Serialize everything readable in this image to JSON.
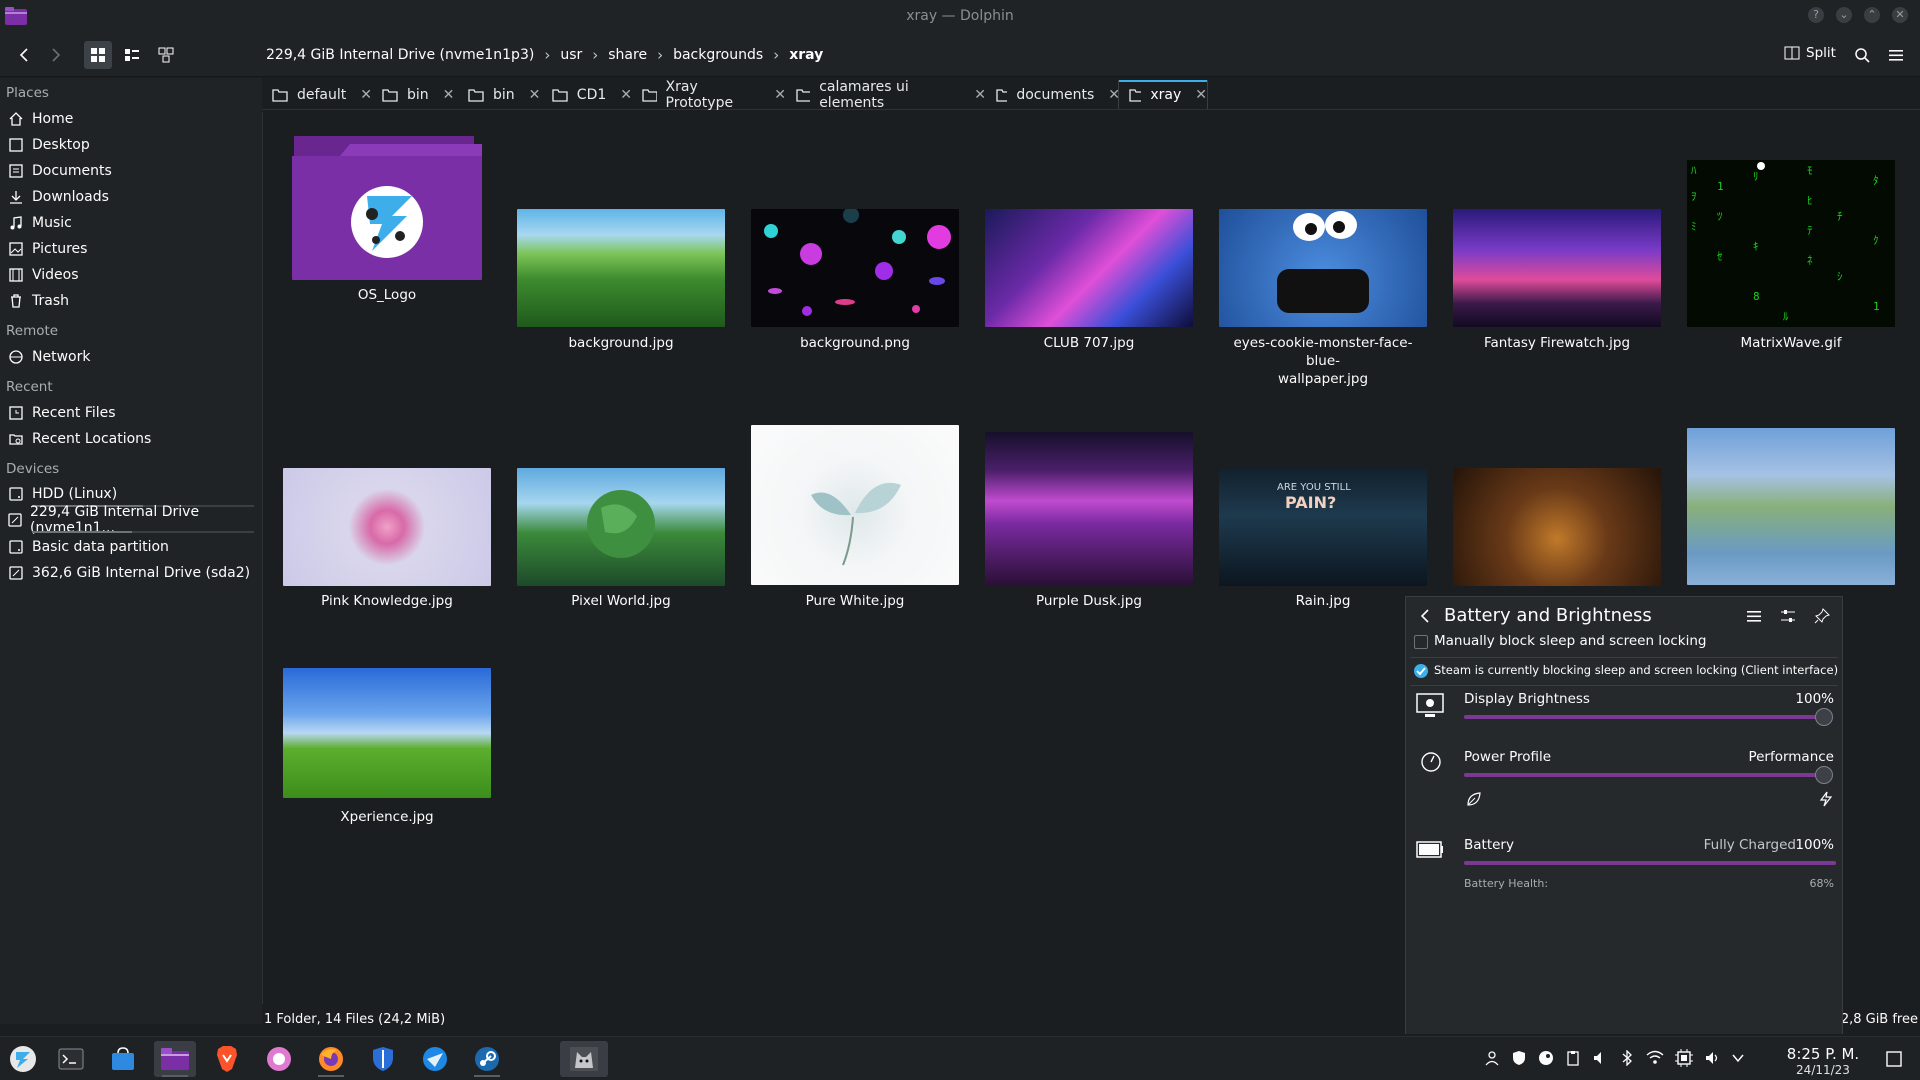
{
  "window": {
    "title": "xray — Dolphin"
  },
  "toolbar": {
    "breadcrumb": [
      "229,4 GiB Internal Drive (nvme1n1p3)",
      "usr",
      "share",
      "backgrounds",
      "xray"
    ],
    "split_label": "Split"
  },
  "sidebar": {
    "places_heading": "Places",
    "places": [
      "Home",
      "Desktop",
      "Documents",
      "Downloads",
      "Music",
      "Pictures",
      "Videos",
      "Trash"
    ],
    "remote_heading": "Remote",
    "remote": [
      "Network"
    ],
    "recent_heading": "Recent",
    "recent": [
      "Recent Files",
      "Recent Locations"
    ],
    "devices_heading": "Devices",
    "devices": [
      {
        "label": "HDD (Linux)",
        "used_fraction": 0.5
      },
      {
        "label": "229,4 GiB Internal Drive (nvme1n1...",
        "used_fraction": 0.45
      },
      {
        "label": "Basic data partition"
      },
      {
        "label": "362,6 GiB Internal Drive (sda2)"
      }
    ]
  },
  "tabs": [
    "default",
    "bin",
    "bin",
    "CD1",
    "Xray Prototype",
    "calamares ui elements",
    "documents",
    "xray"
  ],
  "active_tab": "xray",
  "files": [
    {
      "name": "OS_Logo",
      "kind": "folder"
    },
    {
      "name": "background.jpg"
    },
    {
      "name": "background.png"
    },
    {
      "name": "CLUB 707.jpg"
    },
    {
      "name": "eyes-cookie-monster-face-blue-wallpaper.jpg",
      "line1": "eyes-cookie-monster-face-blue-",
      "line2": "wallpaper.jpg"
    },
    {
      "name": "Fantasy Firewatch.jpg"
    },
    {
      "name": "MatrixWave.gif"
    },
    {
      "name": "Pink Knowledge.jpg"
    },
    {
      "name": "Pixel World.jpg"
    },
    {
      "name": "Pure White.jpg"
    },
    {
      "name": "Purple Dusk.jpg"
    },
    {
      "name": "Rain.jpg"
    },
    {
      "name": "Xperience.jpg"
    }
  ],
  "statusbar": {
    "summary": "1 Folder, 14 Files (24,2 MiB)",
    "free": "2,8 GiB free"
  },
  "popup": {
    "title": "Battery and Brightness",
    "block_sleep_label": "Manually block sleep and screen locking",
    "steam_notice": "Steam is currently blocking sleep and screen locking (Client interface)",
    "brightness": {
      "label": "Display Brightness",
      "value_text": "100%",
      "value": 1.0
    },
    "power_profile": {
      "label": "Power Profile",
      "value_text": "Performance",
      "value": 1.0
    },
    "battery": {
      "label": "Battery",
      "status": "Fully Charged",
      "percent": "100%",
      "level": 1.0,
      "health_label": "Battery Health:",
      "health_value": "68%"
    }
  },
  "clock": {
    "time": "8:25 P. M.",
    "date": "24/11/23"
  },
  "colors": {
    "accent": "#3daee9",
    "purple": "#7a3a93",
    "folder": "#7b2fa6"
  }
}
